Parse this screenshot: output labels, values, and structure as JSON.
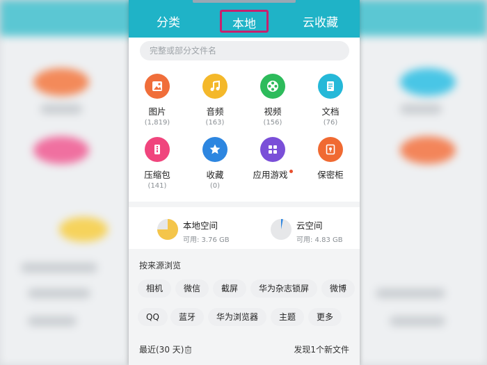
{
  "tabs": [
    {
      "label": "分类"
    },
    {
      "label": "本地"
    },
    {
      "label": "云收藏"
    }
  ],
  "search": {
    "placeholder": "完整或部分文件名"
  },
  "categories": [
    {
      "label": "图片",
      "count": "(1,819)",
      "icon": "image-icon",
      "color": "#f06e3a"
    },
    {
      "label": "音频",
      "count": "(163)",
      "icon": "music-note-icon",
      "color": "#f4b82a"
    },
    {
      "label": "视频",
      "count": "(156)",
      "icon": "film-reel-icon",
      "color": "#2dbb5b"
    },
    {
      "label": "文档",
      "count": "(76)",
      "icon": "document-icon",
      "color": "#25b8d8"
    },
    {
      "label": "压缩包",
      "count": "(141)",
      "icon": "zip-icon",
      "color": "#f0457d"
    },
    {
      "label": "收藏",
      "count": "(0)",
      "icon": "star-icon",
      "color": "#2d86e0"
    },
    {
      "label": "应用游戏",
      "count": "",
      "icon": "apps-grid-icon",
      "color": "#7a4fd8"
    },
    {
      "label": "保密柜",
      "count": "",
      "icon": "safe-icon",
      "color": "#f06a32"
    }
  ],
  "storage": {
    "local": {
      "name": "本地空间",
      "available": "可用: 3.76 GB",
      "used_fraction": 0.75,
      "color": "#f4c54a"
    },
    "cloud": {
      "name": "云空间",
      "available": "可用: 4.83 GB",
      "used_fraction": 0.03,
      "color": "#2d86e0"
    }
  },
  "browse": {
    "title": "按来源浏览",
    "sources": [
      "相机",
      "微信",
      "截屏",
      "华为杂志锁屏",
      "微博",
      "QQ",
      "蓝牙",
      "华为浏览器",
      "主题",
      "更多"
    ]
  },
  "recent": {
    "label": "最近(30 天)",
    "notice": "发现1个新文件"
  },
  "colors": {
    "accent": "#1fb3c7",
    "highlight_box": "#c8206e"
  }
}
